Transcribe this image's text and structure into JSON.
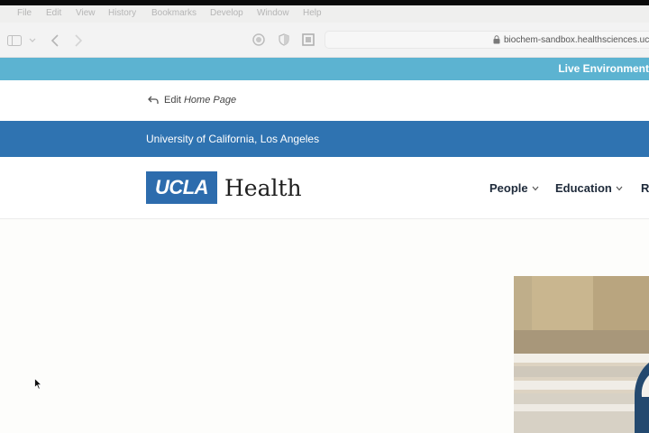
{
  "menubar": {
    "apple": "",
    "items": [
      "File",
      "Edit",
      "View",
      "History",
      "Bookmarks",
      "Develop",
      "Window",
      "Help"
    ]
  },
  "toolbar": {
    "url": "biochem-sandbox.healthsciences.ucla.edu"
  },
  "live_banner": {
    "text": "Live Environment"
  },
  "edit_bar": {
    "prefix": "Edit",
    "page_name": "Home Page"
  },
  "uc_bar": {
    "text": "University of California, Los Angeles"
  },
  "header": {
    "logo_box": "UCLA",
    "logo_word": "Health",
    "nav": [
      {
        "label": "People"
      },
      {
        "label": "Education"
      },
      {
        "label": "R"
      }
    ]
  },
  "colors": {
    "live_banner": "#5cb3d1",
    "uc_bar": "#2f73b1",
    "logo_blue": "#2d6cad"
  }
}
